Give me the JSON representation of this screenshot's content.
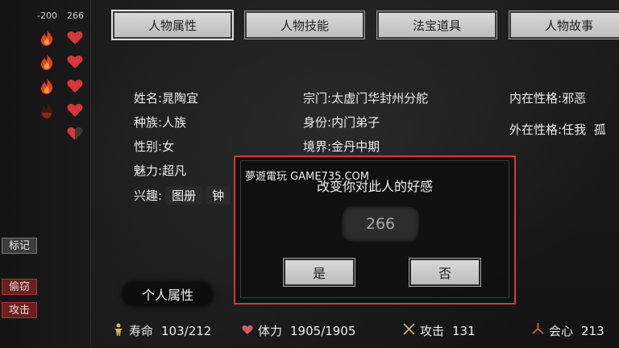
{
  "left_panel": {
    "left_value": "-200",
    "right_value": "266",
    "flame_icon_count": 4,
    "heart_icon_count": 5,
    "buttons": {
      "mark": "标记",
      "steal": "偷窃",
      "attack": "攻击"
    }
  },
  "tabs": [
    "人物属性",
    "人物技能",
    "法宝道具",
    "人物故事"
  ],
  "profile": {
    "name": {
      "label": "姓名:",
      "value": "晁陶宜"
    },
    "race": {
      "label": "种族:",
      "value": "人族"
    },
    "gender": {
      "label": "性别:",
      "value": "女"
    },
    "charm": {
      "label": "魅力:",
      "value": "超凡"
    },
    "hobby": {
      "label": "兴趣:",
      "value": "图册",
      "extra": "钟"
    },
    "sect": {
      "label": "宗门:",
      "value": "太虚门华封州分舵"
    },
    "identity": {
      "label": "身份:",
      "value": "内门弟子"
    },
    "realm": {
      "label": "境界:",
      "value": "金丹中期"
    },
    "inner_personality": {
      "label": "内在性格:",
      "value": "邪恶"
    },
    "outer_personality": {
      "label": "外在性格:",
      "value": "任我",
      "extra": "孤"
    }
  },
  "section": {
    "header": "个人属性"
  },
  "stats": {
    "lifespan": {
      "label": "寿命",
      "value": "103/212"
    },
    "stamina": {
      "label": "体力",
      "value": "1905/1905"
    },
    "attack": {
      "label": "攻击",
      "value": "131"
    },
    "crit": {
      "label": "会心",
      "value": "213"
    }
  },
  "dialog": {
    "watermark": "夢遊電玩 GAME735.COM",
    "title": "改变你对此人的好感",
    "value": "266",
    "yes": "是",
    "no": "否"
  },
  "colors": {
    "highlight_border": "#d8363a",
    "heart": "#d7373b",
    "flame": "#e2411e",
    "button_red": "#6b1f1f"
  }
}
